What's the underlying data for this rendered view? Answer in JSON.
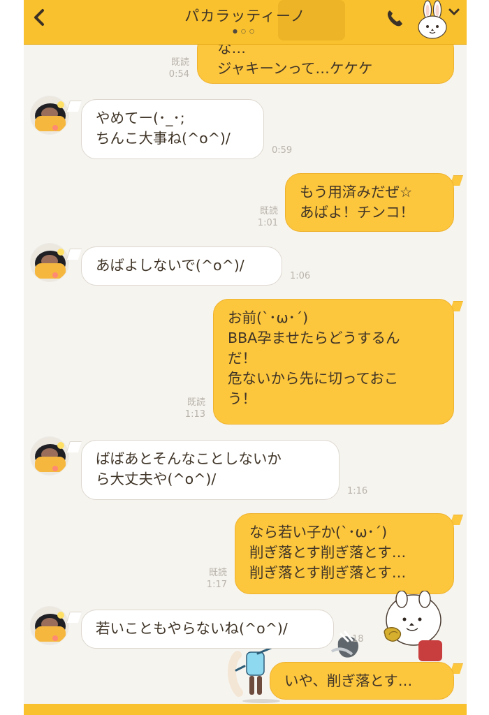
{
  "header": {
    "title": "パカラッティーノ",
    "dots": "●○○"
  },
  "messages": [
    {
      "id": "m0",
      "from": "me",
      "lines": [
        "な…",
        "ジャキーンって…ケケケ"
      ],
      "read": "既読",
      "time": "0:54"
    },
    {
      "id": "m1",
      "from": "other",
      "lines": [
        "やめてー(･_･;",
        "ちんこ大事ね(^o^)/"
      ],
      "time": "0:59"
    },
    {
      "id": "m2",
      "from": "me",
      "lines": [
        "もう用済みだぜ☆",
        "あばよ！チンコ！"
      ],
      "read": "既読",
      "time": "1:01"
    },
    {
      "id": "m3",
      "from": "other",
      "lines": [
        "あばよしないで(^o^)/"
      ],
      "time": "1:06"
    },
    {
      "id": "m4",
      "from": "me",
      "lines": [
        "お前(`･ω･´)",
        "BBA孕ませたらどうするん",
        "だ！",
        "危ないから先に切っておこ",
        "う！"
      ],
      "read": "既読",
      "time": "1:13"
    },
    {
      "id": "m5",
      "from": "other",
      "lines": [
        "ばばあとそんなことしないか",
        "ら大丈夫や(^o^)/"
      ],
      "time": "1:16"
    },
    {
      "id": "m6",
      "from": "me",
      "lines": [
        "なら若い子か(`･ω･´)",
        "削ぎ落とす削ぎ落とす…",
        "削ぎ落とす削ぎ落とす…"
      ],
      "read": "既読",
      "time": "1:17"
    },
    {
      "id": "m7",
      "from": "other",
      "lines": [
        "若いこともやらないね(^o^)/"
      ],
      "time": "18"
    },
    {
      "id": "m8",
      "from": "me",
      "lines": [
        "いや、削ぎ落とす…"
      ]
    }
  ],
  "icons": {
    "back": "chevron-left-icon",
    "call": "phone-icon",
    "avatar": "rabbit-avatar-icon",
    "menu": "chevron-down-icon"
  },
  "colors": {
    "header": "#f9c12d",
    "outgoing": "#fcc63d",
    "incoming": "#ffffff",
    "background": "#f6f4ef"
  }
}
